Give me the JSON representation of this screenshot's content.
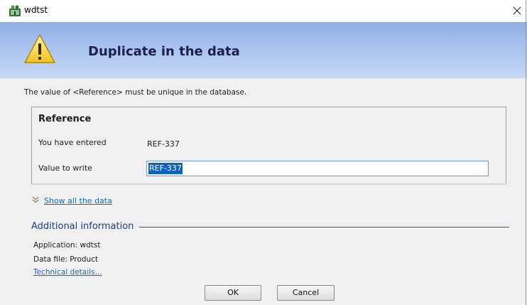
{
  "window": {
    "title": "wdtst",
    "app_icon": "wdtst-app-icon",
    "close_icon": "close-icon"
  },
  "banner": {
    "title": "Duplicate in the data",
    "icon": "warning-icon"
  },
  "message": "The value of <Reference> must be unique in the database.",
  "reference": {
    "title": "Reference",
    "entered_label": "You have entered",
    "entered_value": "REF-337",
    "write_label": "Value to write",
    "write_value": "REF-337"
  },
  "show_all": {
    "label": "Show all the data",
    "icon": "double-chevron-down-icon"
  },
  "additional": {
    "title": "Additional information",
    "application": "Application: wdtst",
    "data_file": "Data file: Product",
    "technical_link": "Technical details..."
  },
  "buttons": {
    "ok": "OK",
    "cancel": "Cancel"
  },
  "colors": {
    "banner_top": "#8fb0e6",
    "banner_bottom": "#c7d8f4",
    "link": "#1a6ab3",
    "selection": "#0a63c4",
    "section_title": "#1c3b8c"
  }
}
